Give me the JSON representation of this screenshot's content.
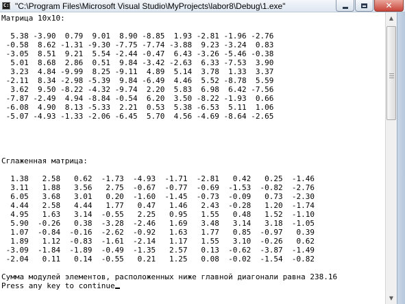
{
  "window": {
    "title": "\"C:\\Program Files\\Microsoft Visual Studio\\MyProjects\\labor8\\Debug\\1.exe\"",
    "icon_name": "console-app-icon",
    "buttons": {
      "minimize": "minimize-icon",
      "maximize": "maximize-icon",
      "close": "close-icon"
    }
  },
  "console": {
    "lines": [
      "Матрица 10x10:",
      "",
      "  5.38 -3.90  0.79  9.01  8.90 -8.85  1.93 -2.81 -1.96 -2.76",
      " -0.58  8.62 -1.31 -9.30 -7.75 -7.74 -3.88  9.23 -3.24  0.83",
      " -3.05  8.51  9.21  5.54 -2.44 -0.47  6.43 -3.26 -5.46 -0.38",
      "  5.01  8.68  2.86  0.51  9.84 -3.42 -2.63  6.33 -7.53  3.90",
      "  3.23  4.84 -9.99  8.25 -9.11  4.89  5.14  3.78  1.33  3.37",
      " -2.11  8.34 -2.98 -5.39  9.84 -6.49  4.46  5.52 -8.78  5.59",
      "  3.62  9.50 -8.22 -4.32 -9.74  2.20  5.83  6.98  6.42 -7.56",
      " -7.87 -2.49  4.94 -8.84 -0.54  6.20  3.50 -8.22 -1.93  0.66",
      " -6.08  4.90  8.13 -5.33  2.21  0.53  5.38 -6.53  5.11  1.06",
      " -5.07 -4.93 -1.33 -2.06 -6.45  5.70  4.56 -4.69 -8.64 -2.65",
      "",
      "",
      "",
      "",
      "Сглаженная матрица:",
      "",
      "  1.38   2.58   0.62  -1.73  -4.93  -1.71  -2.81   0.42   0.25  -1.46",
      "  3.11   1.88   3.56   2.75  -0.67  -0.77  -0.69  -1.53  -0.82  -2.76",
      "  6.05   3.68   3.01   0.20  -1.60  -1.45  -0.73  -0.09   0.73  -2.30",
      "  4.44   2.58   4.44   1.77   0.47   1.46   2.43  -0.28   1.20  -1.74",
      "  4.95   1.63   3.14  -0.55   2.25   0.95   1.55   0.48   1.52  -1.10",
      "  5.90  -0.26   0.38  -3.28  -2.46   1.69   3.48   3.14   3.18  -1.05",
      "  1.07  -0.84  -0.16  -2.62  -0.92   1.63   1.77   0.85  -0.97   0.39",
      "  1.89   1.12  -0.83  -1.61  -2.14   1.17   1.55   3.10  -0.26   0.62",
      " -3.09  -1.84  -1.89  -0.49  -1.35   2.57   0.13  -0.62  -3.87  -1.49",
      " -2.04   0.11   0.14  -0.55   0.21   1.25   0.08  -0.02  -1.54  -0.82",
      "",
      "Сумма модулей элементов, расположенных ниже главной диагонали равна 238.16"
    ],
    "prompt": "Press any key to continue"
  },
  "scrollbar": {
    "up": "scroll-up-arrow-icon",
    "down": "scroll-down-arrow-icon",
    "thumb_fraction": 0.35
  }
}
